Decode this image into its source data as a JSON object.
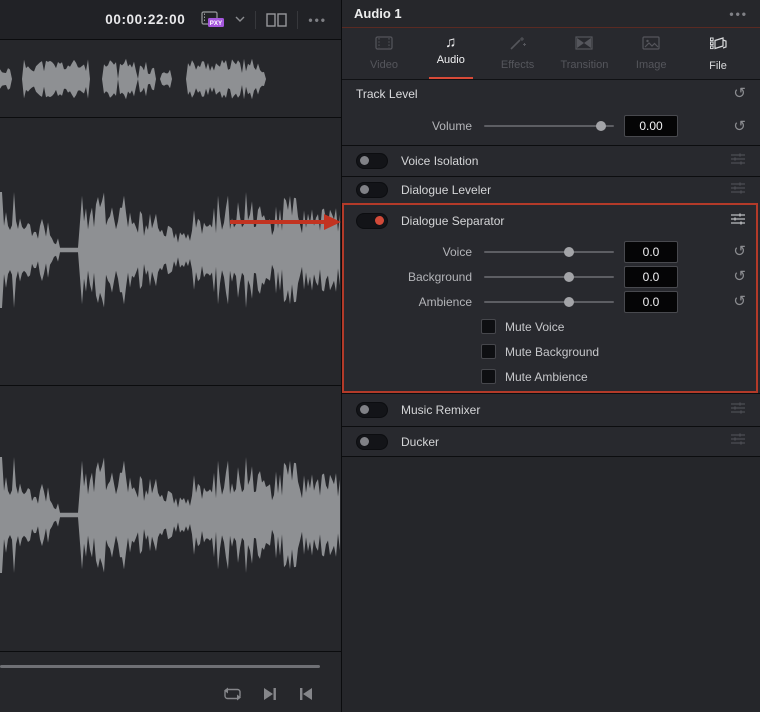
{
  "colors": {
    "waveform": "#8e9093",
    "accent_red": "#d84a38",
    "outline_red": "#b33a29",
    "arrow_red": "#c23320",
    "proxy_purple": "#a557dd"
  },
  "topbar": {
    "timecode": "00:00:22:00",
    "proxy_label": "PXY",
    "menu": "•••"
  },
  "transport": {
    "buttons": [
      "loop",
      "next-frame",
      "previous-frame"
    ]
  },
  "inspector": {
    "title": "Audio 1",
    "menu": "•••",
    "tabs": [
      "Video",
      "Audio",
      "Effects",
      "Transition",
      "Image",
      "File"
    ],
    "active_tab": "Audio",
    "track_level": {
      "title": "Track Level",
      "volume": {
        "label": "Volume",
        "value": "0.00"
      }
    },
    "toggles": {
      "voice_isolation": {
        "label": "Voice Isolation",
        "enabled": false
      },
      "dialogue_leveler": {
        "label": "Dialogue Leveler",
        "enabled": false
      },
      "dialogue_separator": {
        "label": "Dialogue Separator",
        "enabled": true
      },
      "music_remixer": {
        "label": "Music Remixer",
        "enabled": false
      },
      "ducker": {
        "label": "Ducker",
        "enabled": false
      }
    },
    "dialogue_separator": {
      "params": [
        {
          "label": "Voice",
          "value": "0.0"
        },
        {
          "label": "Background",
          "value": "0.0"
        },
        {
          "label": "Ambience",
          "value": "0.0"
        }
      ],
      "checkboxes": [
        {
          "label": "Mute Voice",
          "checked": false
        },
        {
          "label": "Mute Background",
          "checked": false
        },
        {
          "label": "Mute Ambience",
          "checked": false
        }
      ]
    }
  },
  "waveforms": {
    "top": {
      "seed": 11,
      "half": 25,
      "base": 0,
      "segments": [
        [
          0,
          0.03,
          0.5
        ],
        [
          0.07,
          0.26,
          0.8
        ],
        [
          0.3,
          0.345,
          0.75
        ],
        [
          0.35,
          0.4,
          0.85
        ],
        [
          0.41,
          0.455,
          0.55
        ],
        [
          0.47,
          0.5,
          0.5
        ],
        [
          0.55,
          0.7,
          0.8
        ],
        [
          0.7,
          0.78,
          0.65
        ]
      ]
    },
    "mid": {
      "seed": 29,
      "half": 58,
      "base": 0.025,
      "segments": [
        [
          0,
          0.05,
          0.8
        ],
        [
          0.05,
          0.1,
          0.6
        ],
        [
          0.1,
          0.155,
          0.55
        ],
        [
          0.155,
          0.175,
          0.25
        ],
        [
          0.175,
          0.23,
          0.04
        ],
        [
          0.23,
          0.27,
          0.75
        ],
        [
          0.27,
          0.32,
          1.0
        ],
        [
          0.32,
          0.42,
          0.75
        ],
        [
          0.42,
          0.52,
          0.5
        ],
        [
          0.52,
          0.565,
          0.35
        ],
        [
          0.565,
          0.625,
          0.55
        ],
        [
          0.625,
          0.67,
          0.75
        ],
        [
          0.67,
          0.695,
          1.0
        ],
        [
          0.695,
          0.78,
          0.85
        ],
        [
          0.78,
          0.82,
          0.6
        ],
        [
          0.82,
          0.87,
          0.95
        ],
        [
          0.87,
          0.93,
          0.75
        ],
        [
          0.93,
          1.0,
          0.8
        ]
      ]
    },
    "bottom": {
      "seed": 29,
      "half": 58,
      "base": 0.025,
      "segments": [
        [
          0,
          0.05,
          0.8
        ],
        [
          0.05,
          0.1,
          0.6
        ],
        [
          0.1,
          0.155,
          0.55
        ],
        [
          0.155,
          0.175,
          0.25
        ],
        [
          0.175,
          0.23,
          0.04
        ],
        [
          0.23,
          0.27,
          0.75
        ],
        [
          0.27,
          0.32,
          1.0
        ],
        [
          0.32,
          0.42,
          0.75
        ],
        [
          0.42,
          0.52,
          0.5
        ],
        [
          0.52,
          0.565,
          0.35
        ],
        [
          0.565,
          0.625,
          0.55
        ],
        [
          0.625,
          0.67,
          0.75
        ],
        [
          0.67,
          0.695,
          1.0
        ],
        [
          0.695,
          0.78,
          0.85
        ],
        [
          0.78,
          0.82,
          0.6
        ],
        [
          0.82,
          0.87,
          0.95
        ],
        [
          0.87,
          0.93,
          0.75
        ],
        [
          0.93,
          1.0,
          0.8
        ]
      ]
    }
  }
}
